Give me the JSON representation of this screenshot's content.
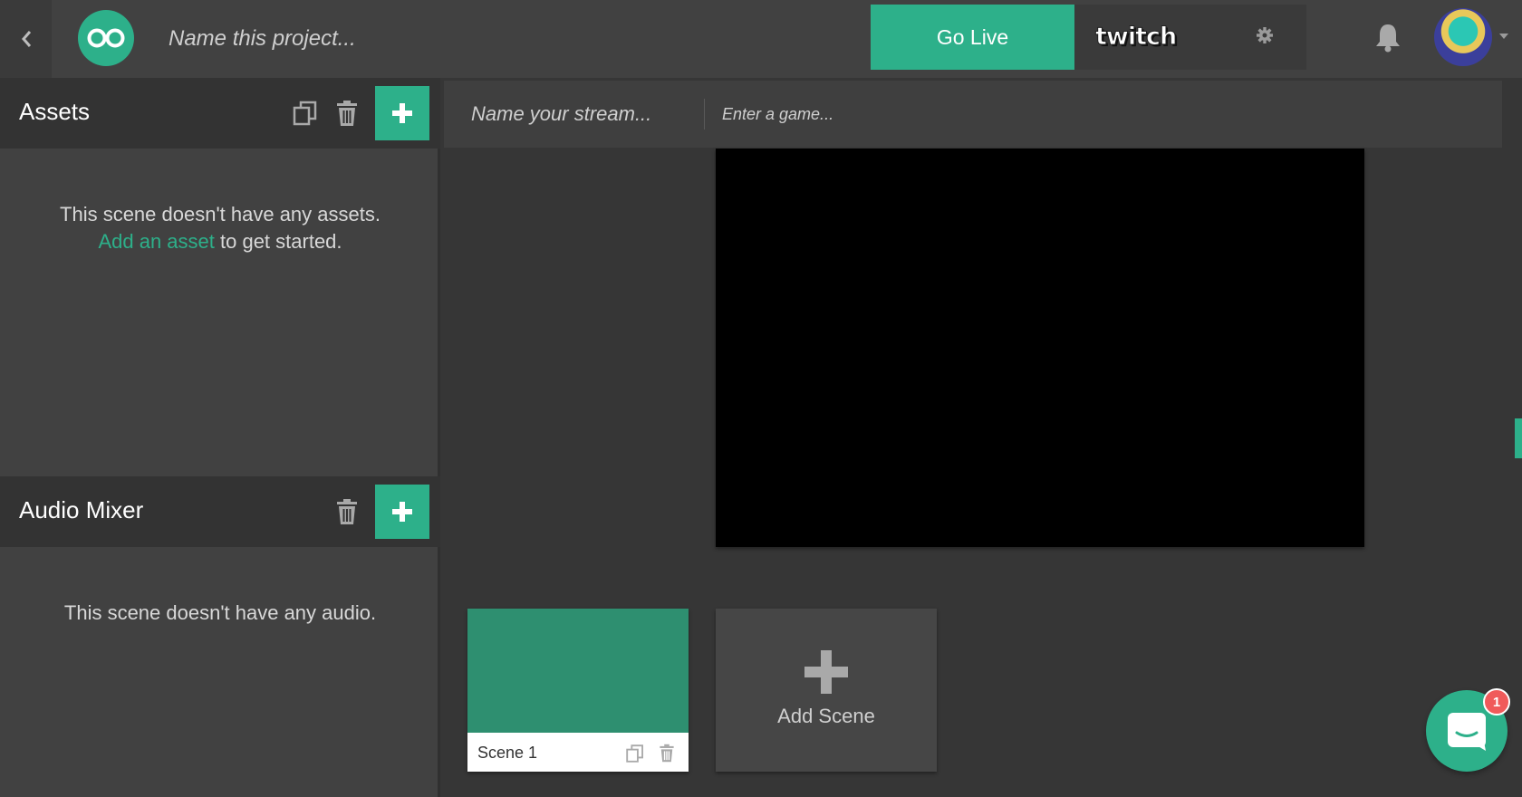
{
  "topbar": {
    "project_placeholder": "Name this project...",
    "golive_label": "Go Live",
    "platform_name": "twitch",
    "icons": {
      "back": "chevron-left-icon",
      "logo": "infinity-logo",
      "settings": "gear-icon",
      "notifications": "bell-icon",
      "avatar": "user-avatar",
      "menu": "caret-down-icon"
    }
  },
  "assets": {
    "title": "Assets",
    "empty_line1": "This scene doesn't have any assets.",
    "empty_link": "Add an asset",
    "empty_line2_suffix": " to get started."
  },
  "audio": {
    "title": "Audio Mixer",
    "empty_msg": "This scene doesn't have any audio."
  },
  "stream": {
    "name_placeholder": "Name your stream...",
    "game_placeholder": "Enter a game..."
  },
  "scenes": {
    "items": [
      {
        "label": "Scene 1",
        "thumb_color": "#2e8f70"
      }
    ],
    "add_label": "Add Scene"
  },
  "chat": {
    "badge_count": "1"
  },
  "colors": {
    "accent": "#2db08a",
    "topbar": "#414141",
    "panel": "#414141",
    "panel_header": "#333333",
    "background": "#363636",
    "badge": "#f05a5a"
  }
}
